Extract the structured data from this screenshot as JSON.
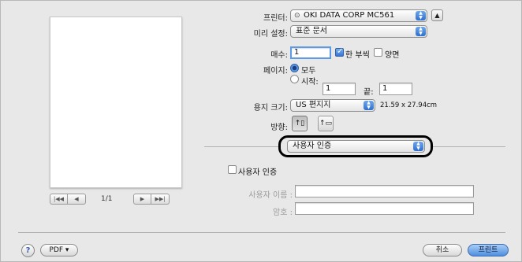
{
  "preview": {
    "page_indicator": "1/1",
    "pager_left": [
      "|◀◀",
      "◀"
    ],
    "pager_right": [
      "▶",
      "▶▶|"
    ]
  },
  "printer": {
    "label": "프린터:",
    "value": "OKI DATA CORP MC561",
    "status_icon": "printer-status-icon",
    "expand_icon": "disclosure-triangle-icon"
  },
  "presets": {
    "label": "미리 설정:",
    "value": "표준 문서"
  },
  "copies": {
    "label": "매수:",
    "value": "1",
    "collated_label": "한 부씩",
    "collated_checked": true,
    "two_sided_label": "양면",
    "two_sided_checked": false
  },
  "pages": {
    "label": "페이지:",
    "all_label": "모두",
    "range_label": "시작:",
    "from_value": "1",
    "to_label": "끝:",
    "to_value": "1",
    "selected": "all"
  },
  "paper_size": {
    "label": "용지 크기:",
    "value": "US 편지지",
    "dimensions": "21.59 x 27.94cm"
  },
  "orientation": {
    "label": "방향:",
    "selected": "portrait"
  },
  "section_popup": {
    "value": "사용자 인증"
  },
  "auth": {
    "checkbox_label": "사용자 인증",
    "checked": false,
    "username_label": "사용자 이름 :",
    "username_value": "",
    "password_label": "암호 :",
    "password_value": ""
  },
  "footer": {
    "help": "?",
    "pdf_label": "PDF ▾",
    "cancel_label": "취소",
    "print_label": "프린트"
  }
}
